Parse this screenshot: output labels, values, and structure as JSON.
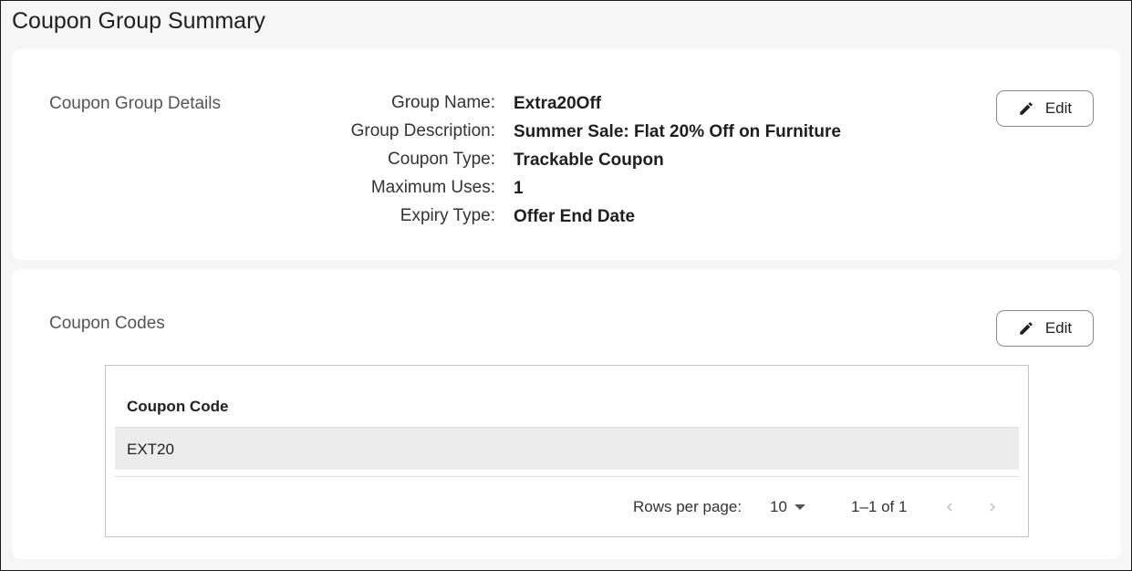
{
  "page": {
    "title": "Coupon Group Summary"
  },
  "details": {
    "section_label": "Coupon Group Details",
    "edit_label": "Edit",
    "fields": [
      {
        "key": "Group Name:",
        "value": "Extra20Off"
      },
      {
        "key": "Group Description:",
        "value": "Summer Sale: Flat 20% Off on Furniture"
      },
      {
        "key": "Coupon Type:",
        "value": "Trackable Coupon"
      },
      {
        "key": "Maximum Uses:",
        "value": "1"
      },
      {
        "key": "Expiry Type:",
        "value": "Offer End Date"
      }
    ]
  },
  "codes": {
    "section_label": "Coupon Codes",
    "edit_label": "Edit",
    "table": {
      "header": "Coupon Code",
      "rows": [
        "EXT20"
      ]
    },
    "pagination": {
      "rows_per_page_label": "Rows per page:",
      "rows_per_page_value": "10",
      "range_text": "1–1 of 1"
    }
  },
  "icons": {
    "edit": "pencil-icon",
    "dropdown": "caret-down-icon",
    "prev": "chevron-left-icon",
    "next": "chevron-right-icon"
  }
}
